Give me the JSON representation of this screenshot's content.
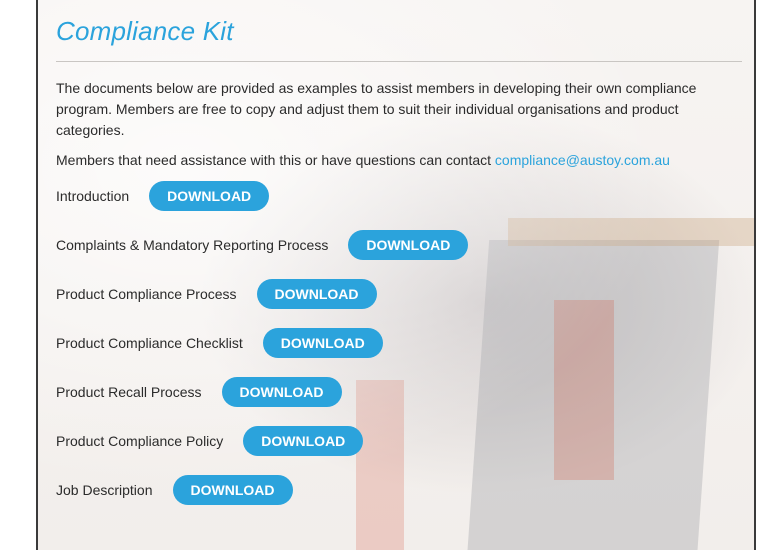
{
  "page": {
    "title": "Compliance Kit",
    "intro": "The documents below are provided as examples to assist members in developing their own compliance program. Members are free to copy and adjust them to suit their individual organisations and product categories.",
    "contact_text": "Members that need assistance with this or have questions can contact ",
    "contact_email": "compliance@austoy.com.au"
  },
  "documents": [
    {
      "label": "Introduction",
      "button": "DOWNLOAD"
    },
    {
      "label": "Complaints & Mandatory Reporting Process",
      "button": "DOWNLOAD"
    },
    {
      "label": "Product Compliance Process",
      "button": "DOWNLOAD"
    },
    {
      "label": "Product Compliance Checklist",
      "button": "DOWNLOAD"
    },
    {
      "label": "Product Recall Process",
      "button": "DOWNLOAD"
    },
    {
      "label": "Product Compliance Policy",
      "button": "DOWNLOAD"
    },
    {
      "label": "Job Description",
      "button": "DOWNLOAD"
    }
  ],
  "colors": {
    "accent": "#2ba3dc",
    "text": "#2b2b2b"
  }
}
